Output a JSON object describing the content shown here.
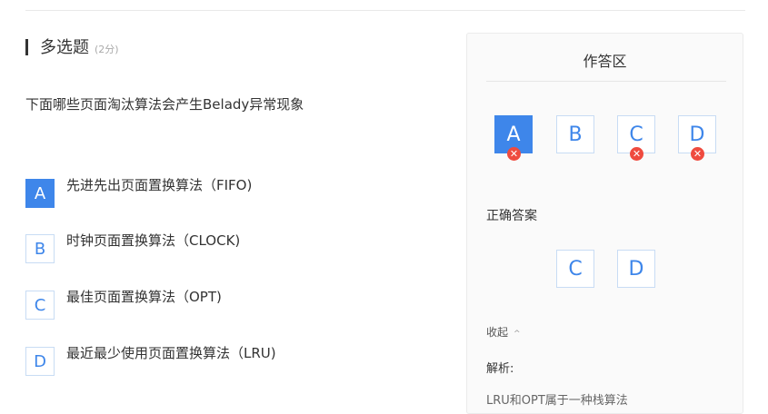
{
  "question": {
    "type": "多选题",
    "score": "(2分)",
    "stem": "下面哪些页面淘汰算法会产生Belady异常现象",
    "options": [
      {
        "letter": "A",
        "text": "先进先出页面置换算法（FIFO)",
        "selected": true
      },
      {
        "letter": "B",
        "text": "时钟页面置换算法（CLOCK)",
        "selected": false
      },
      {
        "letter": "C",
        "text": "最佳页面置换算法（OPT)",
        "selected": false
      },
      {
        "letter": "D",
        "text": "最近最少使用页面置换算法（LRU)",
        "selected": false
      }
    ]
  },
  "panel": {
    "title": "作答区",
    "answers": [
      {
        "letter": "A",
        "selected": true,
        "wrong": true
      },
      {
        "letter": "B",
        "selected": false,
        "wrong": false
      },
      {
        "letter": "C",
        "selected": false,
        "wrong": true
      },
      {
        "letter": "D",
        "selected": false,
        "wrong": true
      }
    ],
    "correct_label": "正确答案",
    "correct_answers": [
      "C",
      "D"
    ],
    "collapse_label": "收起",
    "analysis_label": "解析:",
    "analysis_text": "LRU和OPT属于一种栈算法"
  },
  "colors": {
    "accent": "#3e86ea",
    "wrong": "#ef4b3f",
    "option_border": "#c8dcf4"
  },
  "icons": {
    "wrong_icon": "close-x-circle-icon",
    "collapse_icon": "chevron-up-icon"
  }
}
